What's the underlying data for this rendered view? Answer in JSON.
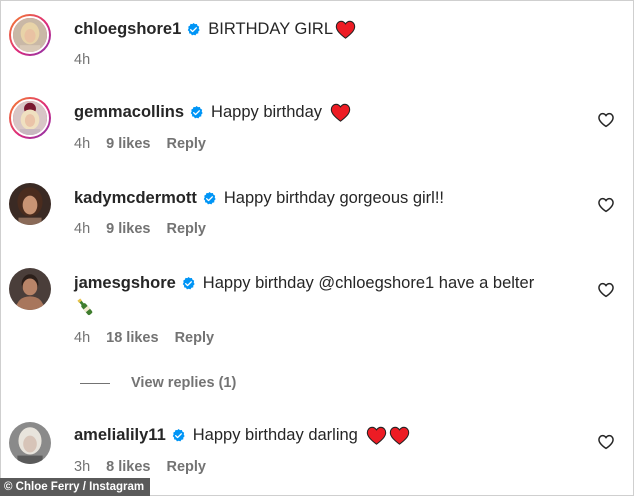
{
  "comments": [
    {
      "username": "chloegshore1",
      "text": "BIRTHDAY GIRL",
      "time": "4h",
      "likes": "",
      "reply": ""
    },
    {
      "username": "gemmacollins",
      "text": "Happy birthday",
      "time": "4h",
      "likes": "9 likes",
      "reply": "Reply"
    },
    {
      "username": "kadymcdermott",
      "text": "Happy birthday gorgeous girl!!",
      "time": "4h",
      "likes": "9 likes",
      "reply": "Reply"
    },
    {
      "username": "jamesgshore",
      "text_before": "Happy birthday ",
      "mention": "@chloegshore1",
      "text_after": " have a belter",
      "time": "4h",
      "likes": "18 likes",
      "reply": "Reply",
      "view_replies": "View replies (1)"
    },
    {
      "username": "amelialily11",
      "text": "Happy birthday darling",
      "time": "3h",
      "likes": "8 likes",
      "reply": "Reply"
    }
  ],
  "credit": "© Chloe Ferry / Instagram",
  "colors": {
    "verified": "#0095f6",
    "heart": "#ed1c24",
    "secondary_text": "#737373",
    "primary_text": "#262626"
  },
  "icons": {
    "verified": "verified-badge-icon",
    "heart": "red-heart-emoji",
    "like": "heart-outline-icon",
    "bottle": "champagne-bottle-emoji"
  }
}
